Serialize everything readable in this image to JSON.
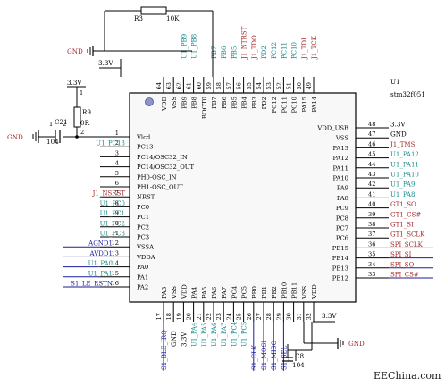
{
  "chip": {
    "refdes": "U1",
    "part": "stm32f051",
    "top_pins": [
      {
        "num": "64",
        "name": "VDD",
        "net": ""
      },
      {
        "num": "63",
        "name": "VSS",
        "net": ""
      },
      {
        "num": "62",
        "name": "PB9",
        "net": "U1_PB9"
      },
      {
        "num": "61",
        "name": "PB8",
        "net": "U1_PB8"
      },
      {
        "num": "60",
        "name": "BOOT0",
        "net": ""
      },
      {
        "num": "59",
        "name": "PB7",
        "net": "PB7"
      },
      {
        "num": "58",
        "name": "PB6",
        "net": "PB6"
      },
      {
        "num": "57",
        "name": "PB5",
        "net": "PB5"
      },
      {
        "num": "56",
        "name": "PB4",
        "net": "J1_NTRST"
      },
      {
        "num": "55",
        "name": "PB3",
        "net": "J1_TDO"
      },
      {
        "num": "54",
        "name": "PD2",
        "net": "PD2"
      },
      {
        "num": "53",
        "name": "PC12",
        "net": "PC12"
      },
      {
        "num": "52",
        "name": "PC11",
        "net": "PC11"
      },
      {
        "num": "51",
        "name": "PC10",
        "net": "PC10"
      },
      {
        "num": "50",
        "name": "PA15",
        "net": "J1_TDI"
      },
      {
        "num": "49",
        "name": "PA14",
        "net": "J1_TCK"
      }
    ],
    "left_pins": [
      {
        "num": "1",
        "name": "Vlcd",
        "net": ""
      },
      {
        "num": "2",
        "name": "PC13",
        "net": "U1_PC13"
      },
      {
        "num": "3",
        "name": "PC14/OSC32_IN",
        "net": ""
      },
      {
        "num": "4",
        "name": "PC14/OSC32_OUT",
        "net": ""
      },
      {
        "num": "5",
        "name": "PH0-OSC_IN",
        "net": ""
      },
      {
        "num": "6",
        "name": "PH1-OSC_OUT",
        "net": ""
      },
      {
        "num": "7",
        "name": "NRST",
        "net": "J1_NSRST"
      },
      {
        "num": "8",
        "name": "PC0",
        "net": "U1_PC0"
      },
      {
        "num": "9",
        "name": "PC1",
        "net": "U1_PC1"
      },
      {
        "num": "10",
        "name": "PC2",
        "net": "U1_PC2"
      },
      {
        "num": "11",
        "name": "PC3",
        "net": "U1_PC3"
      },
      {
        "num": "12",
        "name": "VSSA",
        "net": "AGND1"
      },
      {
        "num": "13",
        "name": "VDDA",
        "net": "AVDD1"
      },
      {
        "num": "14",
        "name": "PA0",
        "net": "U1_PA0"
      },
      {
        "num": "15",
        "name": "PA1",
        "net": "U1_PA1"
      },
      {
        "num": "16",
        "name": "PA2",
        "net": "S1_LE_RSTN"
      }
    ],
    "right_pins": [
      {
        "num": "48",
        "name": "VDD_USB",
        "net": "3.3V"
      },
      {
        "num": "47",
        "name": "VSS",
        "net": "GND"
      },
      {
        "num": "46",
        "name": "PA13",
        "net": "J1_TMS"
      },
      {
        "num": "45",
        "name": "PA12",
        "net": "U1_PA12"
      },
      {
        "num": "44",
        "name": "PA11",
        "net": "U1_PA11"
      },
      {
        "num": "43",
        "name": "PA10",
        "net": "U1_PA10"
      },
      {
        "num": "42",
        "name": "PA9",
        "net": "U1_PA9"
      },
      {
        "num": "41",
        "name": "PA8",
        "net": "U1_PA8"
      },
      {
        "num": "40",
        "name": "PC9",
        "net": "GT1_SO"
      },
      {
        "num": "39",
        "name": "PC8",
        "net": "GT1_CS#"
      },
      {
        "num": "38",
        "name": "PC7",
        "net": "GT1_SI"
      },
      {
        "num": "37",
        "name": "PC6",
        "net": "GT1_SCLK"
      },
      {
        "num": "36",
        "name": "PB15",
        "net": "SPI_SCLK"
      },
      {
        "num": "35",
        "name": "PB14",
        "net": "SPI_SI"
      },
      {
        "num": "34",
        "name": "PB13",
        "net": "SPI_SO"
      },
      {
        "num": "33",
        "name": "PB12",
        "net": "SPI_CS#"
      }
    ],
    "bottom_pins": [
      {
        "num": "17",
        "name": "PA3",
        "net": "S1_BLE_IRQ"
      },
      {
        "num": "18",
        "name": "VSS",
        "net": "GND"
      },
      {
        "num": "19",
        "name": "VDD",
        "net": "3.3V"
      },
      {
        "num": "20",
        "name": "PA4",
        "net": "U1_PA4"
      },
      {
        "num": "21",
        "name": "PA5",
        "net": "U1_PA5"
      },
      {
        "num": "22",
        "name": "PA6",
        "net": "U1_PA6"
      },
      {
        "num": "23",
        "name": "PA7",
        "net": "U1_PA7"
      },
      {
        "num": "24",
        "name": "PC4",
        "net": "U1_PC4"
      },
      {
        "num": "25",
        "name": "PC5",
        "net": "U1_PC5"
      },
      {
        "num": "26",
        "name": "PB0",
        "net": "S1_CLK"
      },
      {
        "num": "27",
        "name": "PB1",
        "net": "S1_MOSI"
      },
      {
        "num": "28",
        "name": "PB2",
        "net": "S1_MISO"
      },
      {
        "num": "29",
        "name": "PB10",
        "net": "S1_SEL"
      },
      {
        "num": "30",
        "name": "PB11",
        "net": ""
      },
      {
        "num": "31",
        "name": "VSS",
        "net": ""
      },
      {
        "num": "32",
        "name": "VDD",
        "net": ""
      }
    ]
  },
  "parts": {
    "r3": {
      "ref": "R3",
      "value": "10K"
    },
    "r9": {
      "ref": "R9",
      "value": "0R"
    },
    "c21": {
      "ref": "C21",
      "value": "104",
      "pin_left": "1",
      "pin_right": "2"
    },
    "c8": {
      "ref": "C8",
      "value": "104"
    }
  },
  "rails": {
    "gnd": "GND",
    "v33": "3.3V",
    "net_3v3_top": "3.3V",
    "net_3v3_left": "3.3V",
    "net_3v3_bottom": "3.3V",
    "r9_pin_top": "1",
    "r9_pin_bottom": "2"
  },
  "watermark": "EEChina.com"
}
